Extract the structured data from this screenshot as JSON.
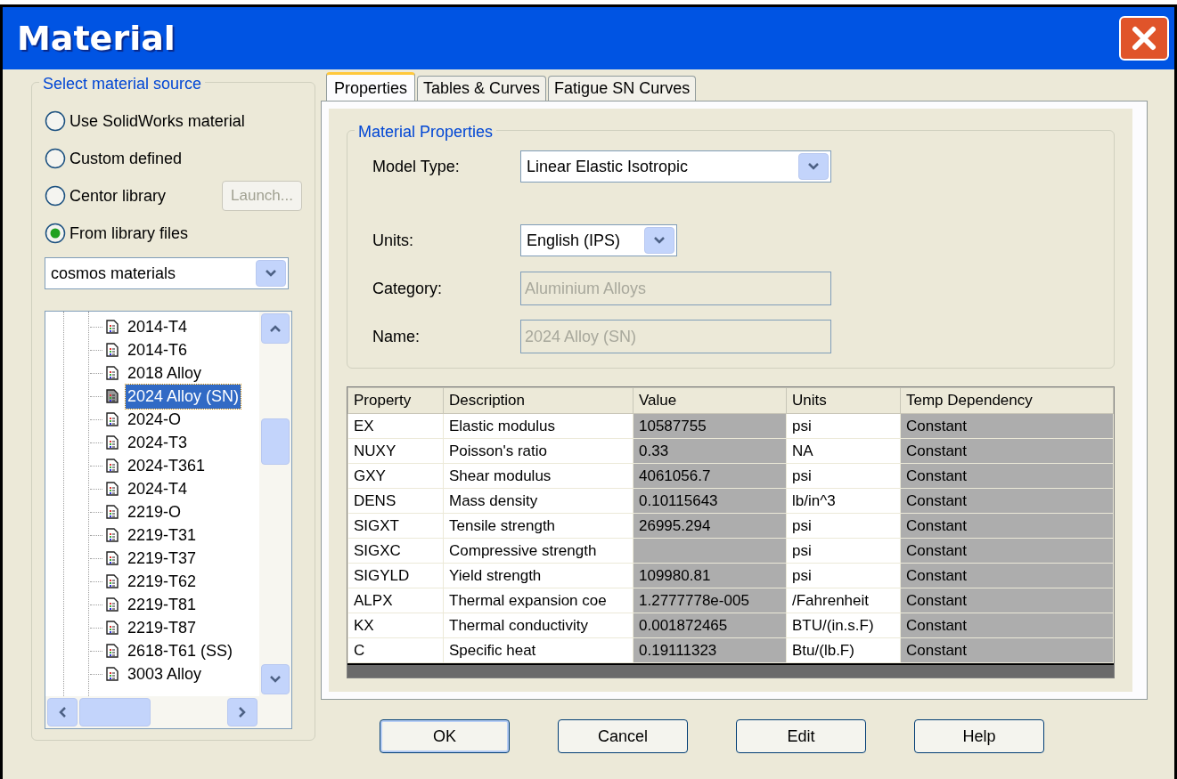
{
  "window": {
    "title": "Material"
  },
  "source_group": {
    "legend": "Select material source",
    "options": [
      {
        "label": "Use SolidWorks material",
        "selected": false
      },
      {
        "label": "Custom defined",
        "selected": false
      },
      {
        "label": "Centor library",
        "selected": false
      },
      {
        "label": "From library files",
        "selected": true
      }
    ],
    "launch_button": {
      "label": "Launch...",
      "disabled": true
    },
    "library_dropdown": {
      "value": "cosmos materials"
    },
    "tree": {
      "items": [
        {
          "label": "2014-T4",
          "selected": false
        },
        {
          "label": "2014-T6",
          "selected": false
        },
        {
          "label": "2018 Alloy",
          "selected": false
        },
        {
          "label": "2024 Alloy (SN)",
          "selected": true
        },
        {
          "label": "2024-O",
          "selected": false
        },
        {
          "label": "2024-T3",
          "selected": false
        },
        {
          "label": "2024-T361",
          "selected": false
        },
        {
          "label": "2024-T4",
          "selected": false
        },
        {
          "label": "2219-O",
          "selected": false
        },
        {
          "label": "2219-T31",
          "selected": false
        },
        {
          "label": "2219-T37",
          "selected": false
        },
        {
          "label": "2219-T62",
          "selected": false
        },
        {
          "label": "2219-T81",
          "selected": false
        },
        {
          "label": "2219-T87",
          "selected": false
        },
        {
          "label": "2618-T61 (SS)",
          "selected": false
        },
        {
          "label": "3003 Alloy",
          "selected": false
        }
      ]
    }
  },
  "tabs": [
    {
      "label": "Properties",
      "selected": true
    },
    {
      "label": "Tables & Curves",
      "selected": false
    },
    {
      "label": "Fatigue SN Curves",
      "selected": false
    }
  ],
  "properties_group": {
    "legend": "Material Properties",
    "fields": [
      {
        "kind": "dropdown",
        "label": "Model Type:",
        "value": "Linear Elastic Isotropic"
      },
      {
        "kind": "dropdown",
        "label": "Units:",
        "value": "English (IPS)"
      },
      {
        "kind": "readonly",
        "label": "Category:",
        "value": "Aluminium Alloys"
      },
      {
        "kind": "readonly",
        "label": "Name:",
        "value": "2024 Alloy (SN)"
      }
    ]
  },
  "table": {
    "columns": [
      {
        "label": "Property",
        "shaded": false
      },
      {
        "label": "Description",
        "shaded": false
      },
      {
        "label": "Value",
        "shaded": true
      },
      {
        "label": "Units",
        "shaded": false
      },
      {
        "label": "Temp Dependency",
        "shaded": true
      }
    ],
    "rows": [
      [
        "EX",
        "Elastic modulus",
        "10587755",
        "psi",
        "Constant"
      ],
      [
        "NUXY",
        "Poisson's ratio",
        "0.33",
        "NA",
        "Constant"
      ],
      [
        "GXY",
        "Shear modulus",
        "4061056.7",
        "psi",
        "Constant"
      ],
      [
        "DENS",
        "Mass density",
        "0.10115643",
        "lb/in^3",
        "Constant"
      ],
      [
        "SIGXT",
        "Tensile strength",
        "26995.294",
        "psi",
        "Constant"
      ],
      [
        "SIGXC",
        "Compressive strength",
        "",
        "psi",
        "Constant"
      ],
      [
        "SIGYLD",
        "Yield strength",
        "109980.81",
        "psi",
        "Constant"
      ],
      [
        "ALPX",
        "Thermal expansion coe",
        "1.2777778e-005",
        "/Fahrenheit",
        "Constant"
      ],
      [
        "KX",
        "Thermal conductivity",
        "0.001872465",
        "BTU/(in.s.F)",
        "Constant"
      ],
      [
        "C",
        "Specific heat",
        "0.19111323",
        "Btu/(lb.F)",
        "Constant"
      ]
    ]
  },
  "buttons": [
    {
      "label": "OK"
    },
    {
      "label": "Cancel"
    },
    {
      "label": "Edit"
    },
    {
      "label": "Help"
    }
  ]
}
